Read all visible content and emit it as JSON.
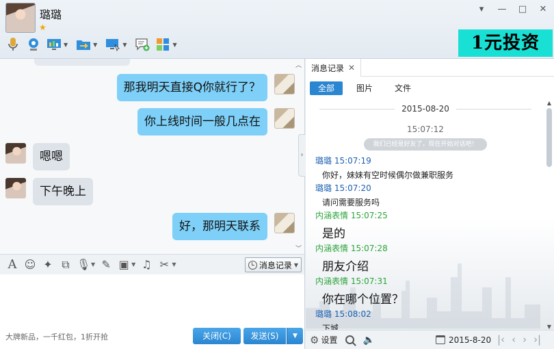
{
  "header": {
    "contact_name": "璐璐",
    "ad_text": "1元投资",
    "window_buttons": [
      "▾",
      "—",
      "□",
      "✕"
    ]
  },
  "chat": {
    "messages": [
      {
        "side": "mine",
        "text": "那我明天直接Q你就行了？"
      },
      {
        "side": "mine",
        "text": "你上线时间一般几点在"
      },
      {
        "side": "theirs",
        "text": "嗯嗯"
      },
      {
        "side": "theirs",
        "text": "下午晚上"
      },
      {
        "side": "mine",
        "text": "好，那明天联系"
      }
    ]
  },
  "input_toolbar": {
    "history_button": "消息记录"
  },
  "input_area": {
    "promo": "大牌新品，一千红包，1折开抢",
    "close_button": "关闭(C)",
    "send_button": "发送(S)"
  },
  "history": {
    "tab_label": "消息记录",
    "filters": [
      "全部",
      "图片",
      "文件"
    ],
    "date": "2015-08-20",
    "center_time": "15:07:12",
    "system_notice": "我们已经是好友了，现在开始对话吧！",
    "entries": [
      {
        "who": "璐璐",
        "role": "her",
        "time": "15:07:19",
        "text": "你好，妹妹有空时候偶尔做兼职服务",
        "size": "small"
      },
      {
        "who": "璐璐",
        "role": "her",
        "time": "15:07:20",
        "text": "请问需要服务吗",
        "size": "small"
      },
      {
        "who": "内涵表情",
        "role": "me",
        "time": "15:07:25",
        "text": "是的",
        "size": "big"
      },
      {
        "who": "内涵表情",
        "role": "me",
        "time": "15:07:28",
        "text": "朋友介绍",
        "size": "big"
      },
      {
        "who": "内涵表情",
        "role": "me",
        "time": "15:07:31",
        "text": "你在哪个位置？",
        "size": "big"
      },
      {
        "who": "璐璐",
        "role": "her",
        "time": "15:08:02",
        "text": "下城",
        "size": "small"
      }
    ],
    "bottom": {
      "settings_label": "设置",
      "date": "2015-8-20"
    }
  }
}
